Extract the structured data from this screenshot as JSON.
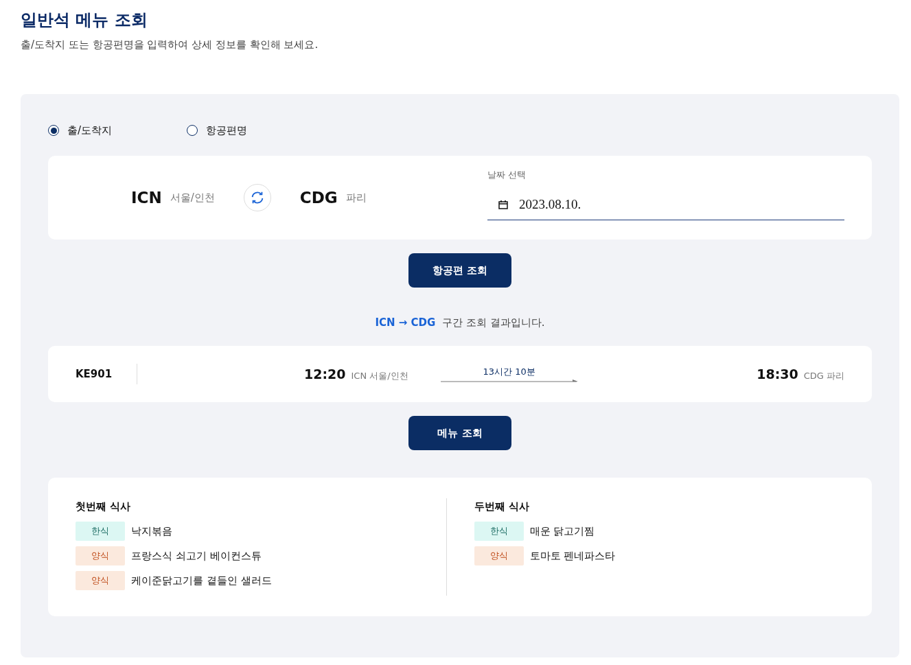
{
  "page": {
    "title": "일반석 메뉴 조회",
    "subtitle": "출/도착지 또는 항공편명을 입력하여 상세 정보를 확인해 보세요."
  },
  "search_modes": [
    {
      "label": "출/도착지",
      "selected": true
    },
    {
      "label": "항공편명",
      "selected": false
    }
  ],
  "route": {
    "origin_code": "ICN",
    "origin_city": "서울/인천",
    "destination_code": "CDG",
    "destination_city": "파리"
  },
  "date": {
    "label": "날짜 선택",
    "value": "2023.08.10."
  },
  "search_button": "항공편 조회",
  "result": {
    "from": "ICN",
    "arrow": "→",
    "to": "CDG",
    "text": "구간 조회 결과입니다."
  },
  "flight": {
    "number": "KE901",
    "departure_time": "12:20",
    "departure_place": "ICN 서울/인천",
    "duration": "13시간 10분",
    "arrival_time": "18:30",
    "arrival_place": "CDG 파리"
  },
  "menu_button": "메뉴 조회",
  "meals": [
    {
      "title": "첫번째 식사",
      "items": [
        {
          "kind": "korean",
          "tag": "한식",
          "name": "낙지볶음"
        },
        {
          "kind": "western",
          "tag": "양식",
          "name": "프랑스식 쇠고기 베이컨스튜"
        },
        {
          "kind": "western",
          "tag": "양식",
          "name": "케이준닭고기를 곁들인 샐러드"
        }
      ]
    },
    {
      "title": "두번째 식사",
      "items": [
        {
          "kind": "korean",
          "tag": "한식",
          "name": "매운 닭고기찜"
        },
        {
          "kind": "western",
          "tag": "양식",
          "name": "토마토 펜네파스타"
        }
      ]
    }
  ]
}
